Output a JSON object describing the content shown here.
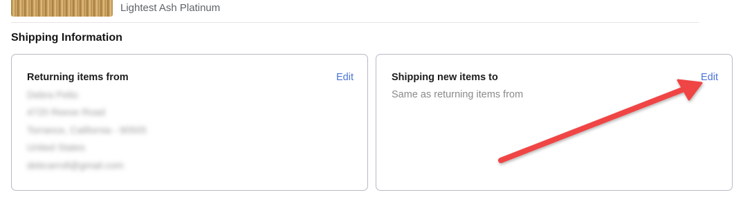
{
  "product": {
    "variant": "Lightest Ash Platinum"
  },
  "shipping": {
    "title": "Shipping Information",
    "returning": {
      "title": "Returning items from",
      "edit_label": "Edit",
      "address_lines": [
        "Debra Pelto",
        "4720 Reese Road",
        "Torrance, California - 90505",
        "United States",
        "debcarroll@gmail.com"
      ]
    },
    "new_items": {
      "title": "Shipping new items to",
      "edit_label": "Edit",
      "subtext": "Same as returning items from"
    }
  },
  "annotation": {
    "arrow_color": "#f04444"
  }
}
